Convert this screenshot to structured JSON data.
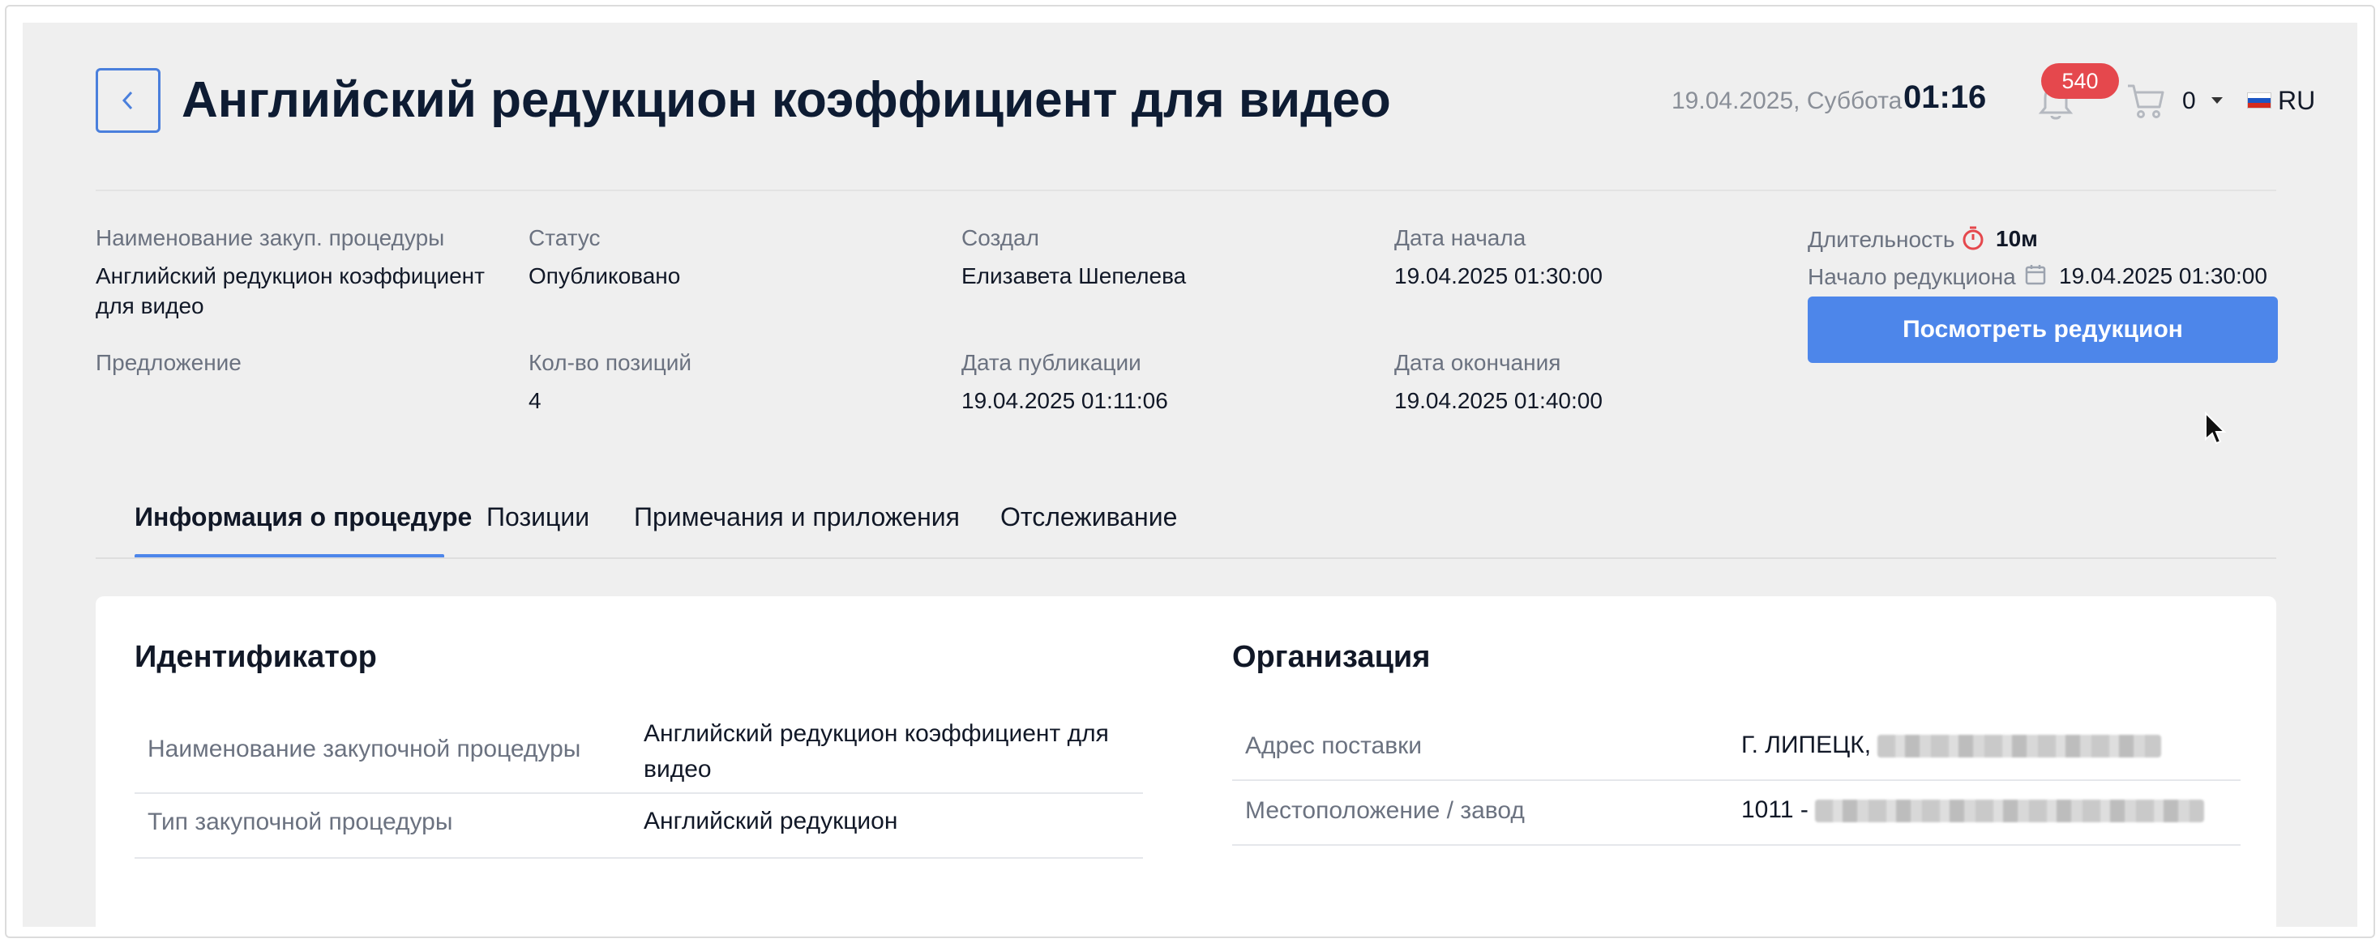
{
  "header": {
    "title": "Английский редукцион коэффициент для видео",
    "date": "19.04.2025, Суббота",
    "time": "01:16",
    "notifications_count": "540",
    "cart_count": "0",
    "language": "RU"
  },
  "info": {
    "procedure_name_label": "Наименование закуп. процедуры",
    "procedure_name_value": "Английский редукцион коэффициент для видео",
    "offer_label": "Предложение",
    "status_label": "Статус",
    "status_value": "Опубликовано",
    "positions_label": "Кол-во позиций",
    "positions_value": "4",
    "created_by_label": "Создал",
    "created_by_value": "Елизавета Шепелева",
    "published_label": "Дата публикации",
    "published_value": "19.04.2025 01:11:06",
    "start_label": "Дата начала",
    "start_value": "19.04.2025 01:30:00",
    "end_label": "Дата окончания",
    "end_value": "19.04.2025 01:40:00",
    "duration_label": "Длительность",
    "duration_value": "10м",
    "reduction_start_label": "Начало редукциона",
    "reduction_start_value": "19.04.2025 01:30:00",
    "view_button": "Посмотреть редукцион"
  },
  "tabs": [
    {
      "label": "Информация о процедуре",
      "active": true
    },
    {
      "label": "Позиции",
      "active": false
    },
    {
      "label": "Примечания и приложения",
      "active": false
    },
    {
      "label": "Отслеживание",
      "active": false
    }
  ],
  "identifier": {
    "title": "Идентификатор",
    "rows": [
      {
        "label": "Наименование закупочной процедуры",
        "value": "Английский редукцион коэффициент для видео"
      },
      {
        "label": "Тип закупочной процедуры",
        "value": "Английский редукцион"
      }
    ]
  },
  "organization": {
    "title": "Организация",
    "rows": [
      {
        "label": "Адрес поставки",
        "value": "Г. ЛИПЕЦК,"
      },
      {
        "label": "Местоположение / завод",
        "value": "1011 -"
      }
    ]
  },
  "colors": {
    "accent": "#4d86ea",
    "badge": "#e5484d",
    "timer": "#e5484d"
  }
}
